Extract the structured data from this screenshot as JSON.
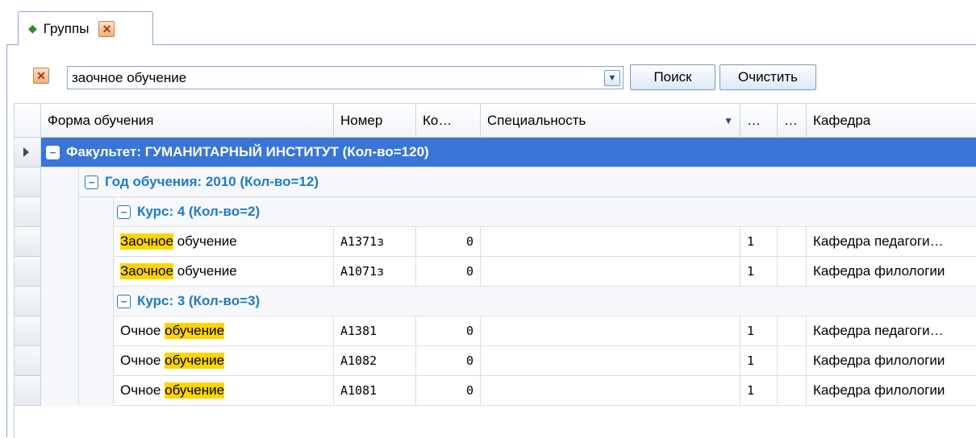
{
  "tab": {
    "label": "Группы",
    "icon": "green-diamond-icon",
    "close_icon": "close-icon"
  },
  "toolbar": {
    "clear_icon": "close-icon",
    "filter_value": "заочное обучение",
    "dropdown_icon": "chevron-down-icon",
    "search_label": "Поиск",
    "clear_label": "Очистить"
  },
  "grid": {
    "columns": [
      "Форма обучения",
      "Номер",
      "Ко…",
      "Специальность",
      "…",
      "…",
      "Кафедра"
    ],
    "sort_icon": "sort-desc-icon",
    "groups": {
      "faculty": "Факультет: ГУМАНИТАРНЫЙ ИНСТИТУТ (Кол-во=120)",
      "year": "Год обучения: 2010 (Кол-во=12)",
      "course4": "Курс: 4 (Кол-во=2)",
      "course3": "Курс: 3 (Кол-во=3)"
    },
    "rows": [
      {
        "form_hl": "Заочное",
        "form_rest": " обучение",
        "number": "А1371з",
        "count": "0",
        "spec": "",
        "c5": "1",
        "c6": "",
        "dept": "Кафедра педагоги…"
      },
      {
        "form_hl": "Заочное",
        "form_rest": " обучение",
        "number": "А1071з",
        "count": "0",
        "spec": "",
        "c5": "1",
        "c6": "",
        "dept": "Кафедра филологии"
      },
      {
        "form_pre": "Очное ",
        "form_hl": "обучение",
        "number": "А1381",
        "count": "0",
        "spec": "",
        "c5": "1",
        "c6": "",
        "dept": "Кафедра педагоги…"
      },
      {
        "form_pre": "Очное ",
        "form_hl": "обучение",
        "number": "А1082",
        "count": "0",
        "spec": "",
        "c5": "1",
        "c6": "",
        "dept": "Кафедра филологии"
      },
      {
        "form_pre": "Очное ",
        "form_hl": "обучение",
        "number": "А1081",
        "count": "0",
        "spec": "",
        "c5": "1",
        "c6": "",
        "dept": "Кафедра филологии"
      }
    ]
  },
  "colors": {
    "accent": "#3875d7",
    "group_text": "#1f7bc4",
    "highlight": "#ffd400"
  }
}
